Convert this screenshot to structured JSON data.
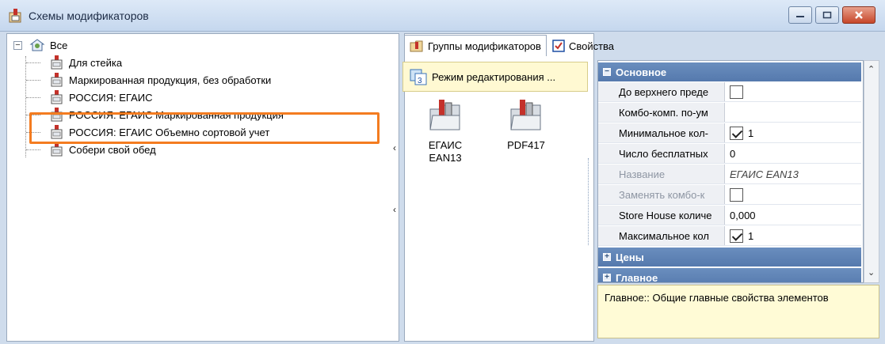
{
  "window": {
    "title": "Схемы модификаторов",
    "controls": [
      "minimize-icon",
      "maximize-icon",
      "close-icon"
    ]
  },
  "tree": {
    "root_label": "Все",
    "items": [
      {
        "label": "Для стейка"
      },
      {
        "label": "Маркированная продукция, без обработки"
      },
      {
        "label": "РОССИЯ: ЕГАИС"
      },
      {
        "label": "РОССИЯ: ЕГАИС Маркированная продукция"
      },
      {
        "label": "РОССИЯ: ЕГАИС Объемно сортовой учет"
      },
      {
        "label": "Собери свой обед"
      }
    ],
    "highlighted_index": 2
  },
  "tabs": [
    {
      "label": "Группы модификаторов",
      "active": true,
      "icon": "folder-bottle-icon"
    },
    {
      "label": "Свойства",
      "active": false,
      "icon": "properties-icon"
    }
  ],
  "edit_mode": {
    "label": "Режим редактирования ..."
  },
  "tiles": [
    {
      "line1": "ЕГАИС",
      "line2": "EAN13"
    },
    {
      "line1": "PDF417",
      "line2": ""
    }
  ],
  "property_grid": {
    "categories": {
      "basic": "Основное",
      "prices": "Цены",
      "main": "Главное"
    },
    "rows": [
      {
        "name": "До верхнего преде",
        "value": "",
        "checkbox": true,
        "checked": false,
        "disabled": false
      },
      {
        "name": "Комбо-комп. по-ум",
        "value": "",
        "checkbox": false,
        "checked": false,
        "disabled": false
      },
      {
        "name": "Минимальное кол-",
        "value": "1",
        "checkbox": true,
        "checked": true,
        "disabled": false
      },
      {
        "name": "Число бесплатных",
        "value": "0",
        "checkbox": false,
        "checked": false,
        "disabled": false
      },
      {
        "name": "Название",
        "value": "ЕГАИС EAN13",
        "checkbox": false,
        "checked": false,
        "disabled": true
      },
      {
        "name": "Заменять комбо-к",
        "value": "",
        "checkbox": true,
        "checked": false,
        "disabled": true
      },
      {
        "name": "Store House количе",
        "value": "0,000",
        "checkbox": false,
        "checked": false,
        "disabled": false
      },
      {
        "name": "Максимальное кол",
        "value": "1",
        "checkbox": true,
        "checked": true,
        "disabled": false
      }
    ]
  },
  "description": "Главное:: Общие главные свойства элементов",
  "colors": {
    "highlight": "#f47c20",
    "category_bg": "#5a7db1",
    "desc_bg": "#fffbd6"
  }
}
